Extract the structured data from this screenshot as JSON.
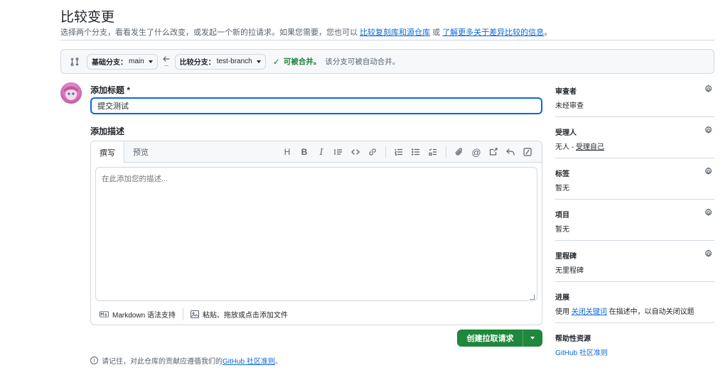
{
  "header": {
    "title": "比较变更",
    "subtitle_prefix": "选择两个分支，看看发生了什么改变，或发起一个新的拉请求。如果您需要，您也可以",
    "link_cross_repo": "比较复刻库和源仓库",
    "subtitle_or": "或",
    "link_learn_more": "了解更多关于差异比较的信息",
    "subtitle_suffix": "。"
  },
  "compare_bar": {
    "base_label": "基础分支：",
    "base_value": "main",
    "compare_label": "比较分支：",
    "compare_value": "test-branch",
    "merge_status": "可被合并。",
    "merge_desc": "该分支可被自动合并。"
  },
  "form": {
    "title_label": "添加标题 *",
    "title_value": "提交测试",
    "description_label": "添加描述",
    "tab_write": "撰写",
    "tab_preview": "预览",
    "description_placeholder": "在此添加您的描述...",
    "markdown_support": "Markdown 语法支持",
    "attach_files": "粘贴、拖放或点击添加文件",
    "create_button": "创建拉取请求"
  },
  "note": {
    "text": "请记住，对此仓库的贡献应遵循我们的",
    "link": "GitHub 社区准则",
    "suffix": "。"
  },
  "sidebar": {
    "reviewers": {
      "title": "审查者",
      "value": "未经审查"
    },
    "assignees": {
      "title": "受理人",
      "value_prefix": "无人 - ",
      "link": "受理自己"
    },
    "labels": {
      "title": "标签",
      "value": "暂无"
    },
    "projects": {
      "title": "项目",
      "value": "暂无"
    },
    "milestone": {
      "title": "里程碑",
      "value": "无里程碑"
    },
    "development": {
      "title": "进展",
      "prefix": "使用",
      "link": "关闭关键词",
      "suffix": "在描述中，以自动关闭议题"
    },
    "helpful": {
      "title": "帮助性资源",
      "link": "GitHub 社区准则"
    }
  },
  "colors": {
    "primary_button": "#1f883d",
    "link": "#0969da",
    "focus_border": "#0969da",
    "success": "#1a7f37"
  },
  "icons": [
    "compare-arrows-icon",
    "left-arrow-icon",
    "check-icon",
    "heading-icon",
    "bold-icon",
    "italic-icon",
    "quote-icon",
    "code-icon",
    "link-icon",
    "ordered-list-icon",
    "unordered-list-icon",
    "task-list-icon",
    "attachment-icon",
    "mention-icon",
    "cross-reference-icon",
    "reply-icon",
    "slash-command-icon",
    "markdown-icon",
    "image-icon",
    "info-icon",
    "gear-icon"
  ]
}
